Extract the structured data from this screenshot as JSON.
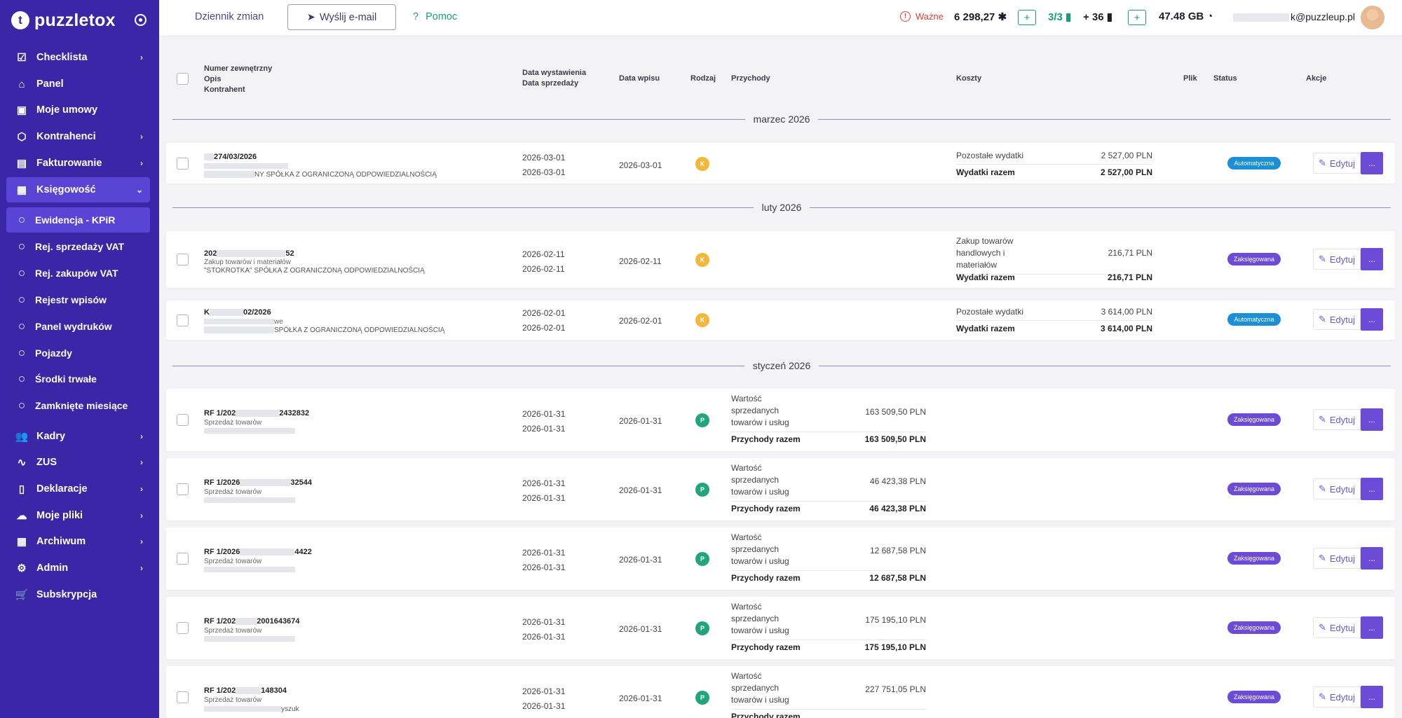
{
  "sidebar": {
    "brand": "puzzletox",
    "items": [
      {
        "label": "Checklista",
        "icon": "checklist-icon",
        "chevron": true
      },
      {
        "label": "Panel",
        "icon": "home-icon",
        "chevron": false
      },
      {
        "label": "Moje umowy",
        "icon": "briefcase-icon",
        "chevron": false
      },
      {
        "label": "Kontrahenci",
        "icon": "box-icon",
        "chevron": true
      },
      {
        "label": "Fakturowanie",
        "icon": "invoice-icon",
        "chevron": true
      },
      {
        "label": "Księgowość",
        "icon": "archive-icon",
        "chevron": true
      }
    ],
    "subitems": [
      {
        "label": "Ewidencja - KPiR"
      },
      {
        "label": "Rej. sprzedaży VAT"
      },
      {
        "label": "Rej. zakupów VAT"
      },
      {
        "label": "Rejestr wpisów"
      },
      {
        "label": "Panel wydruków"
      },
      {
        "label": "Pojazdy"
      },
      {
        "label": "Środki trwałe"
      },
      {
        "label": "Zamknięte miesiące"
      }
    ],
    "items_bottom": [
      {
        "label": "Kadry",
        "icon": "people-icon",
        "chevron": true
      },
      {
        "label": "ZUS",
        "icon": "pulse-icon",
        "chevron": true
      },
      {
        "label": "Deklaracje",
        "icon": "book-icon",
        "chevron": true
      },
      {
        "label": "Moje pliki",
        "icon": "cloud-upload-icon",
        "chevron": true
      },
      {
        "label": "Archiwum",
        "icon": "archive-box-icon",
        "chevron": true
      },
      {
        "label": "Admin",
        "icon": "gear-icon",
        "chevron": true
      },
      {
        "label": "Subskrypcja",
        "icon": "cart-icon",
        "chevron": false
      }
    ]
  },
  "topbar": {
    "changelog": "Dziennik zmian",
    "send_email": "Wyślij e-mail",
    "help": "Pomoc",
    "important": "Ważne",
    "puzzles": "6 298,27",
    "docs_ratio": "3/3",
    "docs_plus": "+ 36",
    "storage": "47.48 GB",
    "email_suffix": "k@puzzleup.pl"
  },
  "table": {
    "headers": {
      "external_number": "Numer zewnętrzny",
      "description": "Opis",
      "contractor": "Kontrahent",
      "issue_date": "Data wystawienia",
      "sale_date": "Data sprzedaży",
      "entry_date": "Data wpisu",
      "kind": "Rodzaj",
      "revenue": "Przychody",
      "costs": "Koszty",
      "file": "Plik",
      "status": "Status",
      "actions": "Akcje"
    },
    "months": [
      "marzec 2026",
      "luty 2026",
      "styczeń 2026"
    ],
    "rows": [
      {
        "number": "274/03/2026",
        "desc": "",
        "contractor": "NY SPÓŁKA Z OGRANICZONĄ ODPOWIEDZIALNOŚCIĄ",
        "issue": "2026-03-01",
        "sale": "2026-03-01",
        "entry": "2026-03-01",
        "kind": "K",
        "cost_label": "Pozostałe wydatki",
        "cost_amount": "2 527,00 PLN",
        "total_label": "Wydatki razem",
        "total_amount": "2 527,00 PLN",
        "status": "Automatyczna"
      },
      {
        "number": "202",
        "number_tail": "52",
        "desc": "Zakup towarów i materiałów",
        "contractor": "\"STOKROTKA\" SPÓŁKA Z OGRANICZONĄ ODPOWIEDZIALNOŚCIĄ",
        "issue": "2026-02-11",
        "sale": "2026-02-11",
        "entry": "2026-02-11",
        "kind": "K",
        "cost_label": "Zakup towarów handlowych i materiałów",
        "cost_amount": "216,71 PLN",
        "total_label": "Wydatki razem",
        "total_amount": "216,71 PLN",
        "status": "Zaksięgowana"
      },
      {
        "number": "K",
        "number_tail": "02/2026",
        "desc": "we",
        "contractor": "SPÓŁKA Z OGRANICZONĄ ODPOWIEDZIALNOŚCIĄ",
        "issue": "2026-02-01",
        "sale": "2026-02-01",
        "entry": "2026-02-01",
        "kind": "K",
        "cost_label": "Pozostałe wydatki",
        "cost_amount": "3 614,00 PLN",
        "total_label": "Wydatki razem",
        "total_amount": "3 614,00 PLN",
        "status": "Automatyczna"
      },
      {
        "number": "RF 1/202",
        "number_tail": "2432832",
        "desc": "Sprzedaż towarów",
        "contractor": "",
        "issue": "2026-01-31",
        "sale": "2026-01-31",
        "entry": "2026-01-31",
        "kind": "P",
        "rev_label": "Wartość sprzedanych towarów i usług",
        "rev_amount": "163 509,50 PLN",
        "total_label": "Przychody razem",
        "total_amount": "163 509,50 PLN",
        "status": "Zaksięgowana"
      },
      {
        "number": "RF 1/2026",
        "number_tail": "32544",
        "desc": "Sprzedaż towarów",
        "contractor": "",
        "issue": "2026-01-31",
        "sale": "2026-01-31",
        "entry": "2026-01-31",
        "kind": "P",
        "rev_label": "Wartość sprzedanych towarów i usług",
        "rev_amount": "46 423,38 PLN",
        "total_label": "Przychody razem",
        "total_amount": "46 423,38 PLN",
        "status": "Zaksięgowana"
      },
      {
        "number": "RF 1/2026",
        "number_tail": "4422",
        "desc": "Sprzedaż towarów",
        "contractor": "",
        "issue": "2026-01-31",
        "sale": "2026-01-31",
        "entry": "2026-01-31",
        "kind": "P",
        "rev_label": "Wartość sprzedanych towarów i usług",
        "rev_amount": "12 687,58 PLN",
        "total_label": "Przychody razem",
        "total_amount": "12 687,58 PLN",
        "status": "Zaksięgowana"
      },
      {
        "number": "RF 1/202",
        "number_tail": "2001643674",
        "desc": "Sprzedaż towarów",
        "contractor": "",
        "issue": "2026-01-31",
        "sale": "2026-01-31",
        "entry": "2026-01-31",
        "kind": "P",
        "rev_label": "Wartość sprzedanych towarów i usług",
        "rev_amount": "175 195,10 PLN",
        "total_label": "Przychody razem",
        "total_amount": "175 195,10 PLN",
        "status": "Zaksięgowana"
      },
      {
        "number": "RF 1/202",
        "number_tail": "148304",
        "desc": "Sprzedaż towarów",
        "contractor": "yszuk",
        "issue": "2026-01-31",
        "sale": "2026-01-31",
        "entry": "2026-01-31",
        "kind": "P",
        "rev_label": "Wartość sprzedanych towarów i usług",
        "rev_amount": "227 751,05 PLN",
        "total_label": "Przychody razem",
        "total_amount": "",
        "status": "Zaksięgowana"
      }
    ],
    "edit_label": "Edytuj",
    "more_label": "..."
  }
}
